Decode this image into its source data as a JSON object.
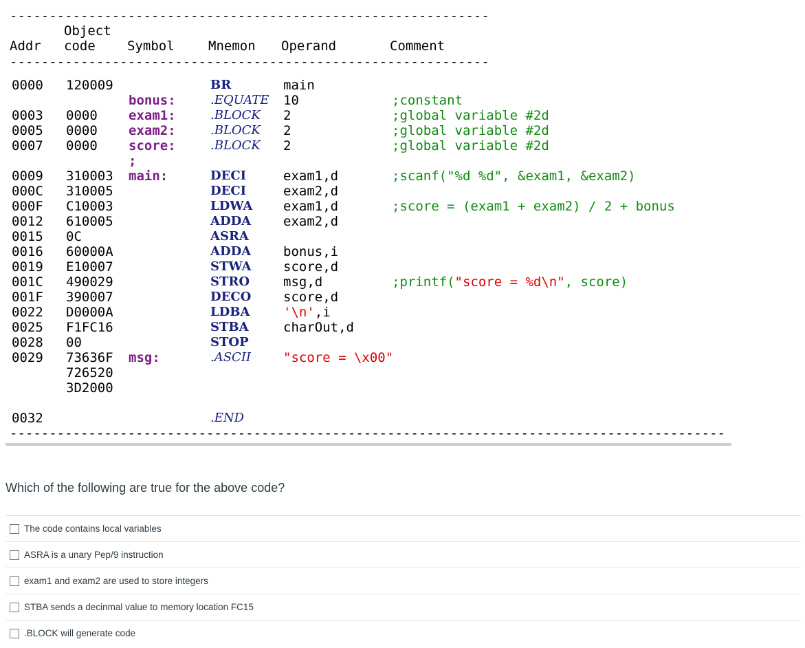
{
  "listing": {
    "dash_line": "----------------------------------------------------------------------------------------------------",
    "headers": {
      "object_top": "Object",
      "addr": "Addr",
      "code": "code",
      "symbol": "Symbol",
      "mnemon": "Mnemon",
      "operand": "Operand",
      "comment": "Comment"
    },
    "rows": [
      {
        "addr": "0000",
        "code": "120009",
        "symbol": "",
        "mnemon": "BR",
        "mtype": "mn",
        "operand": "main",
        "otype": "",
        "comment": "",
        "ctype": ""
      },
      {
        "addr": "",
        "code": "",
        "symbol": "bonus:",
        "mnemon": ".EQUATE",
        "mtype": "dir",
        "operand": "10",
        "otype": "",
        "comment": ";constant",
        "ctype": "cmt"
      },
      {
        "addr": "0003",
        "code": "0000",
        "symbol": "exam1:",
        "mnemon": ".BLOCK",
        "mtype": "dir",
        "operand": "2",
        "otype": "",
        "comment": ";global variable #2d",
        "ctype": "cmt"
      },
      {
        "addr": "0005",
        "code": "0000",
        "symbol": "exam2:",
        "mnemon": ".BLOCK",
        "mtype": "dir",
        "operand": "2",
        "otype": "",
        "comment": ";global variable #2d",
        "ctype": "cmt"
      },
      {
        "addr": "0007",
        "code": "0000",
        "symbol": "score:",
        "mnemon": ".BLOCK",
        "mtype": "dir",
        "operand": "2",
        "otype": "",
        "comment": ";global variable #2d",
        "ctype": "cmt"
      },
      {
        "addr": "",
        "code": "",
        "symbol": ";",
        "mnemon": "",
        "mtype": "",
        "operand": "",
        "otype": "",
        "comment": "",
        "ctype": ""
      },
      {
        "addr": "0009",
        "code": "310003",
        "symbol": "main:",
        "mnemon": "DECI",
        "mtype": "mn",
        "operand": "exam1,d",
        "otype": "",
        "comment": ";scanf(\"%d %d\", &exam1, &exam2)",
        "ctype": "cmt"
      },
      {
        "addr": "000C",
        "code": "310005",
        "symbol": "",
        "mnemon": "DECI",
        "mtype": "mn",
        "operand": "exam2,d",
        "otype": "",
        "comment": "",
        "ctype": ""
      },
      {
        "addr": "000F",
        "code": "C10003",
        "symbol": "",
        "mnemon": "LDWA",
        "mtype": "mn",
        "operand": "exam1,d",
        "otype": "",
        "comment": ";score = (exam1 + exam2) / 2 + bonus",
        "ctype": "cmt"
      },
      {
        "addr": "0012",
        "code": "610005",
        "symbol": "",
        "mnemon": "ADDA",
        "mtype": "mn",
        "operand": "exam2,d",
        "otype": "",
        "comment": "",
        "ctype": ""
      },
      {
        "addr": "0015",
        "code": "0C",
        "symbol": "",
        "mnemon": "ASRA",
        "mtype": "mn",
        "operand": "",
        "otype": "",
        "comment": "",
        "ctype": ""
      },
      {
        "addr": "0016",
        "code": "60000A",
        "symbol": "",
        "mnemon": "ADDA",
        "mtype": "mn",
        "operand": "bonus,i",
        "otype": "",
        "comment": "",
        "ctype": ""
      },
      {
        "addr": "0019",
        "code": "E10007",
        "symbol": "",
        "mnemon": "STWA",
        "mtype": "mn",
        "operand": "score,d",
        "otype": "",
        "comment": "",
        "ctype": ""
      },
      {
        "addr": "001C",
        "code": "490029",
        "symbol": "",
        "mnemon": "STRO",
        "mtype": "mn",
        "operand": "msg,d",
        "otype": "",
        "comment": ";printf(\"score = %d\\n\", score)",
        "ctype": "cmt"
      },
      {
        "addr": "001F",
        "code": "390007",
        "symbol": "",
        "mnemon": "DECO",
        "mtype": "mn",
        "operand": "score,d",
        "otype": "",
        "comment": "",
        "ctype": ""
      },
      {
        "addr": "0022",
        "code": "D0000A",
        "symbol": "",
        "mnemon": "LDBA",
        "mtype": "mn",
        "operand": "'\\n',i",
        "otype": "mix",
        "comment": "",
        "ctype": ""
      },
      {
        "addr": "0025",
        "code": "F1FC16",
        "symbol": "",
        "mnemon": "STBA",
        "mtype": "mn",
        "operand": "charOut,d",
        "otype": "",
        "comment": "",
        "ctype": ""
      },
      {
        "addr": "0028",
        "code": "00",
        "symbol": "",
        "mnemon": "STOP",
        "mtype": "mn",
        "operand": "",
        "otype": "",
        "comment": "",
        "ctype": ""
      },
      {
        "addr": "0029",
        "code": "73636F",
        "symbol": "msg:",
        "mnemon": ".ASCII",
        "mtype": "dir",
        "operand": "\"score = \\x00\"",
        "otype": "str",
        "comment": "",
        "ctype": ""
      },
      {
        "addr": "",
        "code": "726520",
        "symbol": "",
        "mnemon": "",
        "mtype": "",
        "operand": "",
        "otype": "",
        "comment": "",
        "ctype": ""
      },
      {
        "addr": "",
        "code": "3D2000",
        "symbol": "",
        "mnemon": "",
        "mtype": "",
        "operand": "",
        "otype": "",
        "comment": "",
        "ctype": ""
      },
      {
        "addr": "",
        "code": "",
        "symbol": "",
        "mnemon": "",
        "mtype": "",
        "operand": "",
        "otype": "",
        "comment": "",
        "ctype": ""
      },
      {
        "addr": "0032",
        "code": "",
        "symbol": "",
        "mnemon": ".END",
        "mtype": "dir",
        "operand": "",
        "otype": "",
        "comment": "",
        "ctype": ""
      }
    ]
  },
  "question": {
    "text": "Which of the following are true for the above code?",
    "options": [
      {
        "label": "The code contains local variables",
        "checked": false
      },
      {
        "label": "ASRA is a unary Pep/9 instruction",
        "checked": false
      },
      {
        "label": "exam1 and exam2 are used to store integers",
        "checked": false
      },
      {
        "label": "STBA sends a decinmal value to memory location FC15",
        "checked": false
      },
      {
        "label": ".BLOCK will generate code",
        "checked": false
      }
    ]
  }
}
